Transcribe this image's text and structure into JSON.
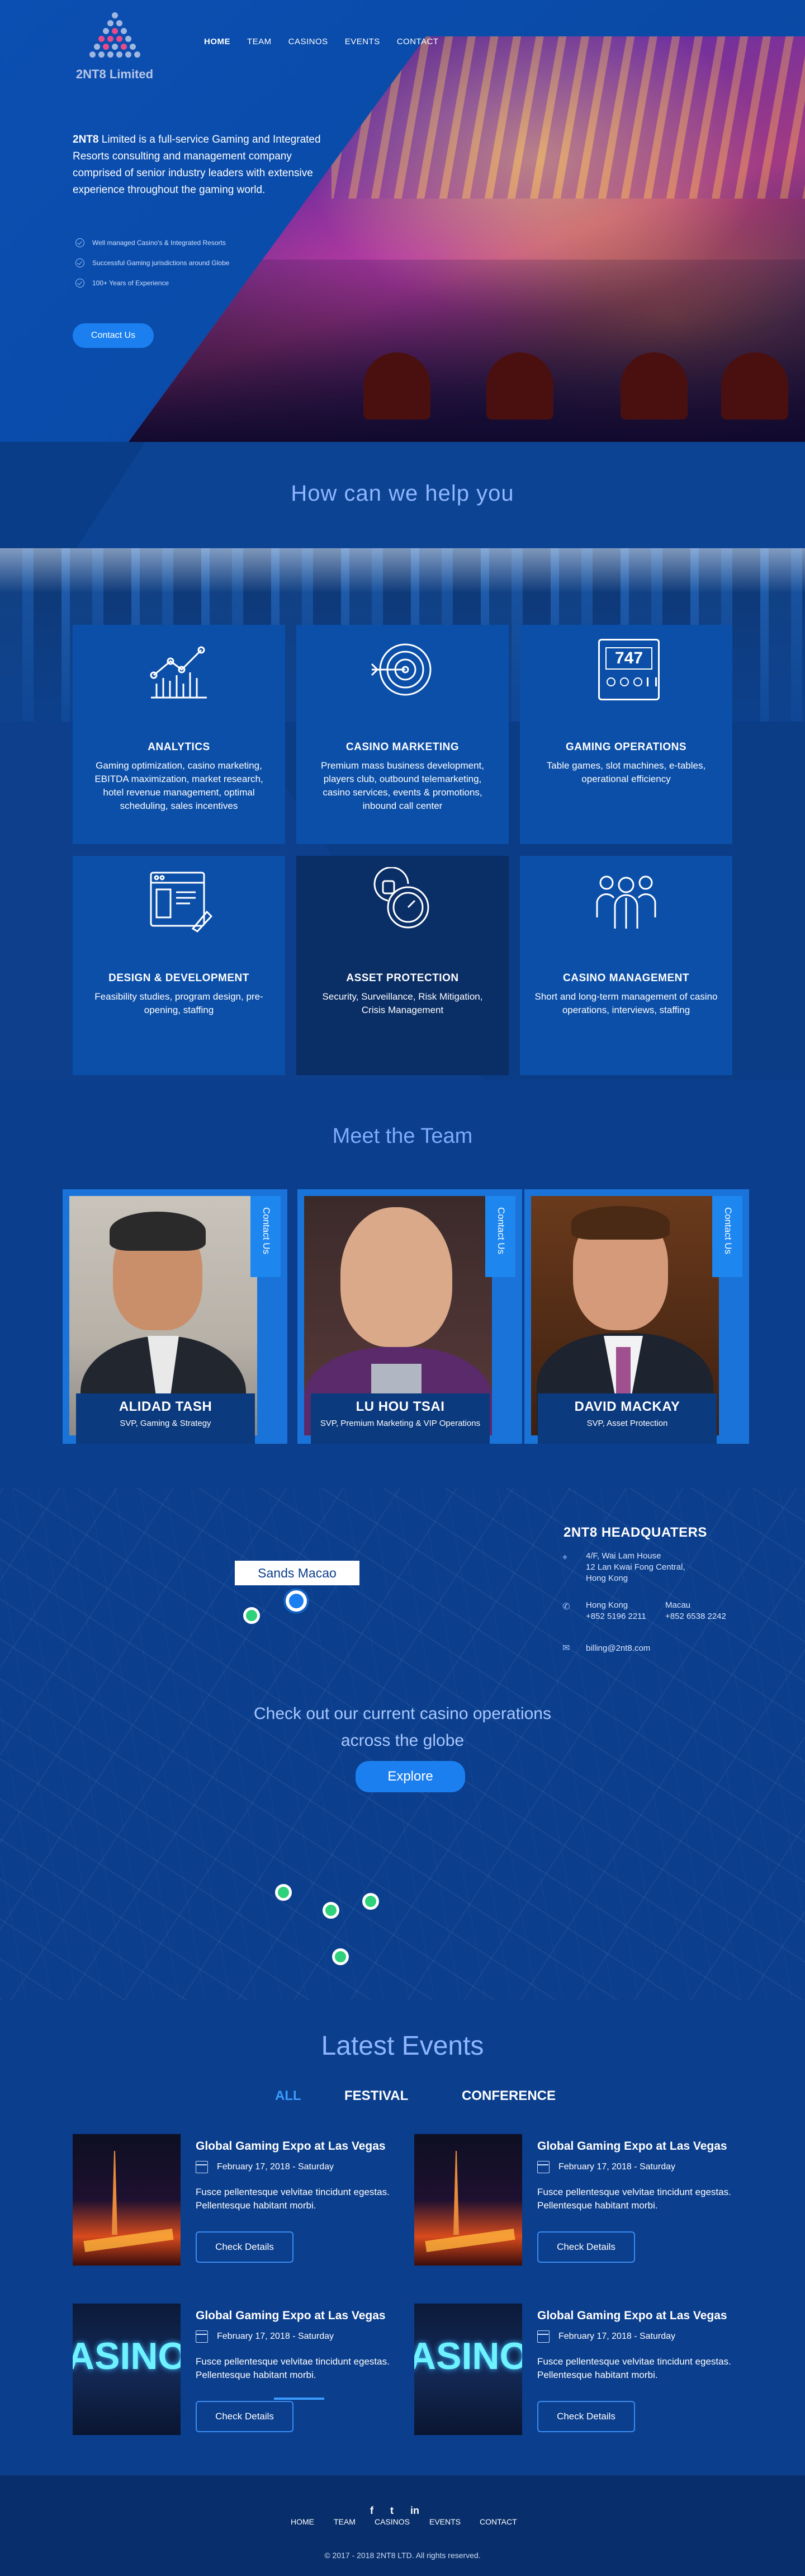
{
  "brand": {
    "logo_text": "2NT8 Limited"
  },
  "nav": {
    "items": [
      "HOME",
      "TEAM",
      "CASINOS",
      "EVENTS",
      "CONTACT"
    ],
    "active": "HOME"
  },
  "hero": {
    "company": "2NT8",
    "intro": " Limited is a full-service Gaming and Integrated Resorts consulting and management company comprised of senior industry leaders with extensive experience throughout the gaming world.",
    "checks": [
      "Well managed Casino's & Integrated Resorts",
      "Successful Gaming jurisdictions around Globe",
      "100+ Years of Experience"
    ],
    "cta": "Contact Us"
  },
  "help": {
    "title": "How can we help you"
  },
  "services": [
    {
      "title": "ANALYTICS",
      "desc": "Gaming optimization, casino marketing, EBITDA maximization, market research, hotel revenue management, optimal scheduling, sales incentives",
      "icon": "chart-icon"
    },
    {
      "title": "CASINO MARKETING",
      "desc": "Premium mass business development, players club, outbound telemarketing, casino services, events & promotions, inbound call center",
      "icon": "target-icon"
    },
    {
      "title": "GAMING OPERATIONS",
      "desc": "Table games, slot machines, e-tables, operational efficiency",
      "icon": "slot-machine-icon",
      "slot_digits": "747"
    },
    {
      "title": "DESIGN & DEVELOPMENT",
      "desc": "Feasibility studies, program design, pre-opening, staffing",
      "icon": "design-icon"
    },
    {
      "title": "ASSET PROTECTION",
      "desc": "Security, Surveillance, Risk Mitigation, Crisis Management",
      "icon": "lock-icon"
    },
    {
      "title": "CASINO MANAGEMENT",
      "desc": "Short and long-term management of casino operations, interviews, staffing",
      "icon": "team-icon"
    }
  ],
  "team": {
    "title": "Meet the Team",
    "tab_label": "Contact Us",
    "members": [
      {
        "name": "ALIDAD TASH",
        "role": "SVP, Gaming & Strategy"
      },
      {
        "name": "LU HOU TSAI",
        "role": "SVP, Premium Marketing & VIP Operations"
      },
      {
        "name": "DAVID MACKAY",
        "role": "SVP, Asset Protection"
      }
    ]
  },
  "map": {
    "label": "Sands Macao",
    "hq_title": "2NT8 HEADQUATERS",
    "address": [
      "4/F, Wai Lam House",
      "12 Lan Kwai Fong Central,",
      "Hong Kong"
    ],
    "phones": [
      {
        "city": "Hong Kong",
        "number": "+852 5196 2211"
      },
      {
        "city": "Macau",
        "number": "+852 6538 2242"
      }
    ],
    "email": "billing@2nt8.com",
    "cta": [
      "Check out our current casino operations",
      "across the globe"
    ],
    "button": "Explore"
  },
  "events": {
    "title": "Latest Events",
    "filters": [
      "ALL",
      "FESTIVAL",
      "CONFERENCE"
    ],
    "active_filter": "ALL",
    "items": [
      {
        "title": "Global Gaming Expo at Las Vegas",
        "date": "February 17, 2018 - Saturday",
        "desc": "Fusce pellentesque velvitae tincidunt egestas. Pellentesque habitant morbi.",
        "button": "Check Details"
      },
      {
        "title": "Global Gaming Expo at Las Vegas",
        "date": "February 17, 2018 - Saturday",
        "desc": "Fusce pellentesque velvitae tincidunt egestas. Pellentesque habitant morbi.",
        "button": "Check Details"
      },
      {
        "title": "Global Gaming Expo at Las Vegas",
        "date": "February 17, 2018 - Saturday",
        "desc": "Fusce pellentesque velvitae tincidunt egestas. Pellentesque habitant morbi.",
        "button": "Check Details"
      },
      {
        "title": "Global Gaming Expo at Las Vegas",
        "date": "February 17, 2018 - Saturday",
        "desc": "Fusce pellentesque velvitae tincidunt egestas. Pellentesque habitant morbi.",
        "button": "Check Details"
      }
    ],
    "casino_sign": "ASINO"
  },
  "footer": {
    "social": [
      "f",
      "t",
      "in"
    ],
    "nav": [
      "HOME",
      "TEAM",
      "CASINOS",
      "EVENTS",
      "CONTACT"
    ],
    "copyright": "© 2017 - 2018 2NT8 LTD. All rights reserved."
  },
  "colors": {
    "accent": "#1b7ff0",
    "background": "#0b3e8c",
    "pin": "#2fd17a"
  }
}
